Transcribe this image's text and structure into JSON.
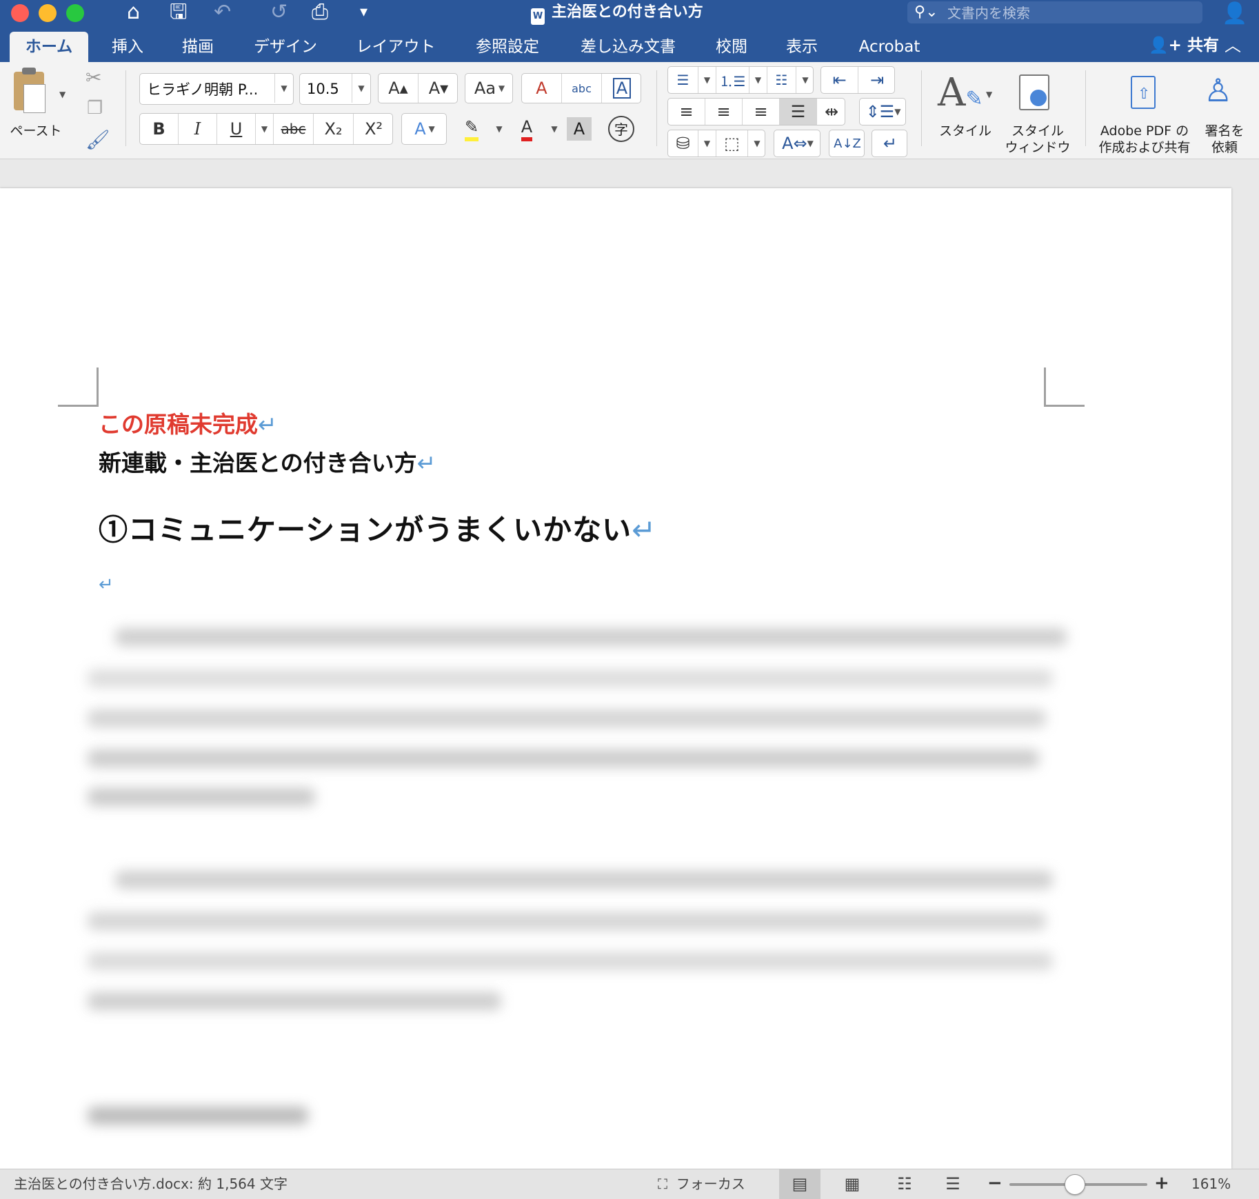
{
  "window": {
    "title": "主治医との付き合い方",
    "doc_icon": "W"
  },
  "quick_access": {
    "home_icon": "⌂",
    "save_icon": "🖫",
    "undo_icon": "↶",
    "redo_icon": "↺",
    "print_icon": "⎙",
    "customize_icon": "▾"
  },
  "search": {
    "placeholder": "文書内を検索",
    "icon": "search-icon"
  },
  "tabs": [
    {
      "label": "ホーム"
    },
    {
      "label": "挿入"
    },
    {
      "label": "描画"
    },
    {
      "label": "デザイン"
    },
    {
      "label": "レイアウト"
    },
    {
      "label": "参照設定"
    },
    {
      "label": "差し込み文書"
    },
    {
      "label": "校閲"
    },
    {
      "label": "表示"
    },
    {
      "label": "Acrobat"
    }
  ],
  "share_label": "共有",
  "ribbon": {
    "paste_label": "ペースト",
    "font_name": "ヒラギノ明朝 P...",
    "font_size": "10.5",
    "buttons": {
      "grow": "A▴",
      "shrink": "A▾",
      "change_case": "Aa",
      "clear_format": "A",
      "phonetic": "abc",
      "char_border": "A",
      "bold": "B",
      "italic": "I",
      "underline": "U",
      "strike": "abc",
      "subscript": "X₂",
      "superscript": "X²",
      "text_effect": "A",
      "highlight": "✎",
      "font_color": "A",
      "char_shading": "A",
      "enclose": "字"
    },
    "styles_label": "スタイル",
    "styles_pane_label_1": "スタイル",
    "styles_pane_label_2": "ウィンドウ",
    "adobe_label_1": "Adobe PDF の",
    "adobe_label_2": "作成および共有",
    "sign_label_1": "署名を",
    "sign_label_2": "依頼"
  },
  "document": {
    "line1": "この原稿未完成",
    "line2": "新連載・主治医との付き合い方",
    "line3": "①コミュニケーションがうまくいかない",
    "para_mark": "↵"
  },
  "status": {
    "doc_info": "主治医との付き合い方.docx: 約 1,564 文字",
    "focus_label": "フォーカス",
    "zoom_percent": 161,
    "zoom_label": "161%",
    "zoom_slider_fraction": 0.47
  },
  "colors": {
    "word_blue": "#2b579a",
    "unfinished_red": "#e03a2f",
    "para_mark_blue": "#5b9bd5"
  }
}
